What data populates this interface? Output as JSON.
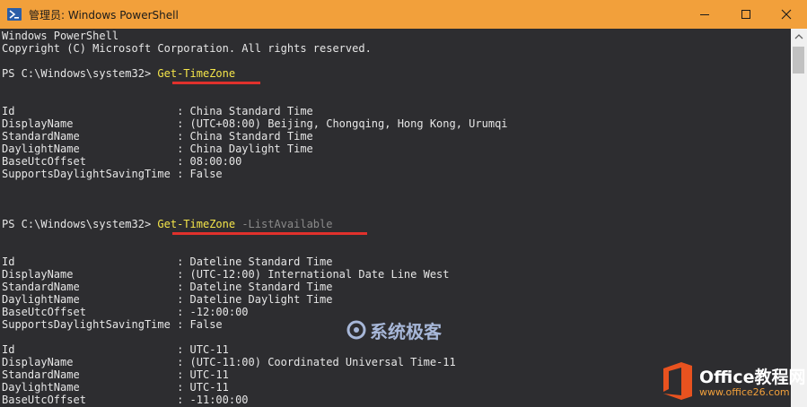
{
  "window": {
    "title": "管理员: Windows PowerShell",
    "buttons": {
      "minimize": "minimize",
      "maximize": "maximize",
      "close": "close"
    }
  },
  "console": {
    "banner": [
      "Windows PowerShell",
      "Copyright (C) Microsoft Corporation. All rights reserved."
    ],
    "prompts": [
      {
        "prompt": "PS C:\\Windows\\system32> ",
        "command": "Get-TimeZone",
        "parameter": ""
      },
      {
        "prompt": "PS C:\\Windows\\system32> ",
        "command": "Get-TimeZone",
        "parameter": " -ListAvailable"
      }
    ],
    "output1": [
      "Id                         : China Standard Time",
      "DisplayName                : (UTC+08:00) Beijing, Chongqing, Hong Kong, Urumqi",
      "StandardName               : China Standard Time",
      "DaylightName               : China Daylight Time",
      "BaseUtcOffset              : 08:00:00",
      "SupportsDaylightSavingTime : False"
    ],
    "output2": [
      "Id                         : Dateline Standard Time",
      "DisplayName                : (UTC-12:00) International Date Line West",
      "StandardName               : Dateline Standard Time",
      "DaylightName               : Dateline Daylight Time",
      "BaseUtcOffset              : -12:00:00",
      "SupportsDaylightSavingTime : False"
    ],
    "output3": [
      "Id                         : UTC-11",
      "DisplayName                : (UTC-11:00) Coordinated Universal Time-11",
      "StandardName               : UTC-11",
      "DaylightName               : UTC-11",
      "BaseUtcOffset              : -11:00:00"
    ]
  },
  "watermark": {
    "text": "系统极客"
  },
  "brand": {
    "name": "Office教程网",
    "url": "www.office26.com"
  },
  "colors": {
    "titlebar": "#f2a03b",
    "console_bg": "#2d2d30",
    "command": "#f4e54a",
    "underline": "#e0312c"
  }
}
